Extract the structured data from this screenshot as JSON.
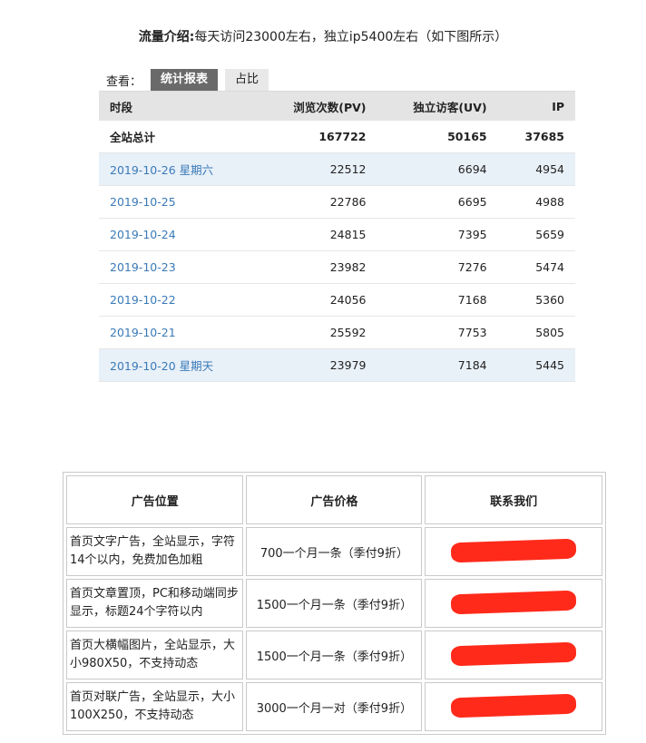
{
  "intro": {
    "label": "流量介绍:",
    "text": "每天访问23000左右，独立ip5400左右（如下图所示）"
  },
  "view": {
    "label": "查看：",
    "tabs": [
      "统计报表",
      "占比"
    ],
    "active_tab": "统计报表"
  },
  "stats_table": {
    "headers": [
      "时段",
      "浏览次数(PV)",
      "独立访客(UV)",
      "IP"
    ],
    "total": {
      "label": "全站总计",
      "pv": "167722",
      "uv": "50165",
      "ip": "37685"
    },
    "rows": [
      {
        "date": "2019-10-26 星期六",
        "pv": "22512",
        "uv": "6694",
        "ip": "4954",
        "highlight": true
      },
      {
        "date": "2019-10-25",
        "pv": "22786",
        "uv": "6695",
        "ip": "4988",
        "highlight": false
      },
      {
        "date": "2019-10-24",
        "pv": "24815",
        "uv": "7395",
        "ip": "5659",
        "highlight": false
      },
      {
        "date": "2019-10-23",
        "pv": "23982",
        "uv": "7276",
        "ip": "5474",
        "highlight": false
      },
      {
        "date": "2019-10-22",
        "pv": "24056",
        "uv": "7168",
        "ip": "5360",
        "highlight": false
      },
      {
        "date": "2019-10-21",
        "pv": "25592",
        "uv": "7753",
        "ip": "5805",
        "highlight": false
      },
      {
        "date": "2019-10-20 星期天",
        "pv": "23979",
        "uv": "7184",
        "ip": "5445",
        "highlight": true
      }
    ]
  },
  "ads_table": {
    "headers": [
      "广告位置",
      "广告价格",
      "联系我们"
    ],
    "rows": [
      {
        "position": "首页文字广告，全站显示，字符14个以内，免费加色加粗",
        "price": "700一个月一条（季付9折）"
      },
      {
        "position": "首页文章置顶，PC和移动端同步显示，标题24个字符以内",
        "price": "1500一个月一条（季付9折）"
      },
      {
        "position": "首页大横幅图片，全站显示，大小980X50，不支持动态",
        "price": "1500一个月一条（季付9折）"
      },
      {
        "position": "首页对联广告，全站显示，大小100X250，不支持动态",
        "price": "3000一个月一对（季付9折）"
      }
    ]
  },
  "colors": {
    "link": "#3a7ab8",
    "highlight_row": "#e8f0f8",
    "header_bg": "#e4e4e4",
    "active_tab": "#6a6a6a",
    "redaction": "#ff2a1a"
  }
}
